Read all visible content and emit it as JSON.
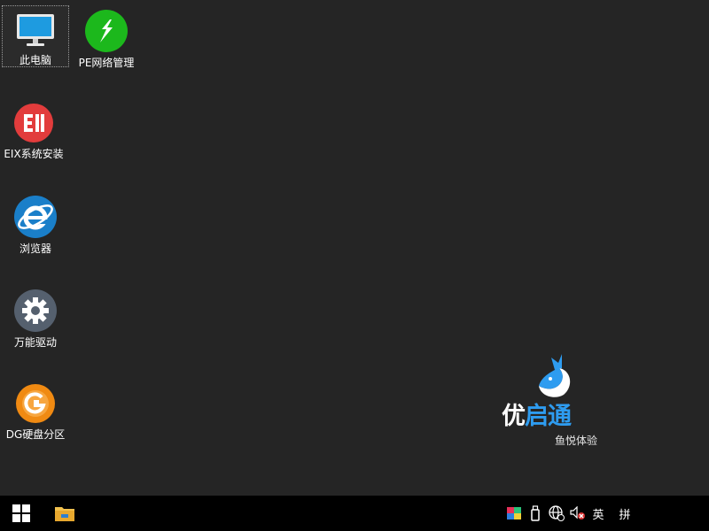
{
  "desktop": {
    "icons": [
      {
        "label": "此电脑",
        "icon": "computer-icon"
      },
      {
        "label": "PE网络管理",
        "icon": "network-manager-icon"
      },
      {
        "label": "EIX系统安装",
        "icon": "eix-install-icon"
      },
      {
        "label": "浏览器",
        "icon": "browser-icon"
      },
      {
        "label": "万能驱动",
        "icon": "gear-icon"
      },
      {
        "label": "DG硬盘分区",
        "icon": "diskgenius-icon"
      }
    ]
  },
  "brand": {
    "name_part1": "优",
    "name_part2": "启通",
    "slogan": "鱼悦体验",
    "logo": "fish-logo-icon"
  },
  "taskbar": {
    "start": "windows-start-icon",
    "pinned": [
      {
        "icon": "file-explorer-icon"
      }
    ],
    "tray": {
      "icons": [
        "color-palette-icon",
        "usb-device-icon",
        "network-globe-icon",
        "volume-muted-icon"
      ],
      "ime_lang": "英",
      "ime_mode": "拼"
    }
  },
  "colors": {
    "desktop_bg": "#252525",
    "taskbar_bg": "#000000",
    "network_green": "#1cb81c",
    "eix_red": "#e23c3c",
    "browser_blue": "#1a7fc9",
    "driver_slate": "#55606e",
    "dg_orange": "#f08a12",
    "brand_blue": "#2e9cf0"
  }
}
